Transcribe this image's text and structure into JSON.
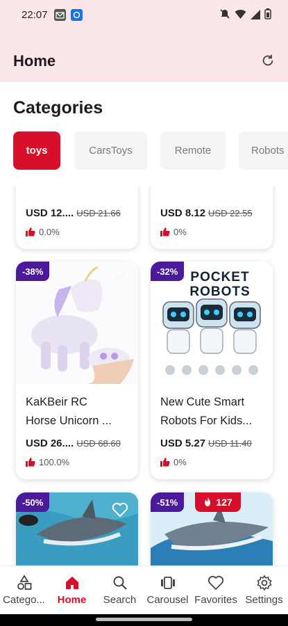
{
  "status_bar": {
    "time": "22:07"
  },
  "app_bar": {
    "title": "Home"
  },
  "categories": {
    "title": "Categories",
    "chips": [
      {
        "label": "toys",
        "active": true
      },
      {
        "label": "CarsToys",
        "active": false
      },
      {
        "label": "Remote",
        "active": false
      },
      {
        "label": "Robots",
        "active": false
      }
    ]
  },
  "products_partial_top": [
    {
      "name": "",
      "price": "USD 12....",
      "old_price": "USD 21.66",
      "rating": "0.0%"
    },
    {
      "name": "",
      "price": "USD 8.12",
      "old_price": "USD 22.55",
      "rating": "0%"
    }
  ],
  "products": [
    {
      "discount": "-38%",
      "name_line1": "KaKBeir RC",
      "name_line2": "Horse Unicorn ...",
      "price": "USD 26....",
      "old_price": "USD 68.60",
      "rating": "100.0%"
    },
    {
      "discount": "-32%",
      "name_line1": "New Cute Smart",
      "name_line2": "Robots For Kids...",
      "price": "USD 5.27",
      "old_price": "USD 11.40",
      "rating": "0%",
      "image_text": "POCKET ROBOTS"
    }
  ],
  "products_partial_bottom": [
    {
      "discount": "-50%"
    },
    {
      "discount": "-51%",
      "hot_count": "127"
    }
  ],
  "bottom_nav": [
    {
      "label": "Catego...",
      "icon": "category-shapes-icon",
      "active": false
    },
    {
      "label": "Home",
      "icon": "home-icon",
      "active": true
    },
    {
      "label": "Search",
      "icon": "search-icon",
      "active": false
    },
    {
      "label": "Carousel",
      "icon": "carousel-icon",
      "active": false
    },
    {
      "label": "Favorites",
      "icon": "heart-icon",
      "active": false
    },
    {
      "label": "Settings",
      "icon": "gear-icon",
      "active": false
    }
  ],
  "colors": {
    "accent": "#d80f2b",
    "discount_badge": "#4a1a9a",
    "app_bar_bg": "#fbe7ea"
  }
}
